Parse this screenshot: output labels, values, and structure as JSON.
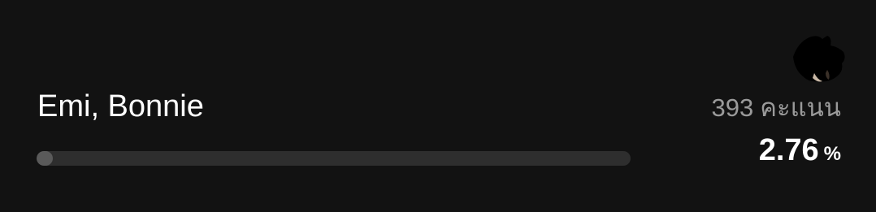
{
  "option": {
    "name": "Emi, Bonnie",
    "votes_count": "393",
    "votes_unit": "คะแนน",
    "percent_value": "2.76",
    "percent_sign": "%",
    "progress_fraction": 0.0276
  },
  "sticker": {
    "icon": "cat-sticker-icon"
  },
  "colors": {
    "background": "#121212",
    "track": "#2e2e2e",
    "fill": "#5a5a5a",
    "text": "#ffffff",
    "muted_text": "#9a9a9a"
  }
}
